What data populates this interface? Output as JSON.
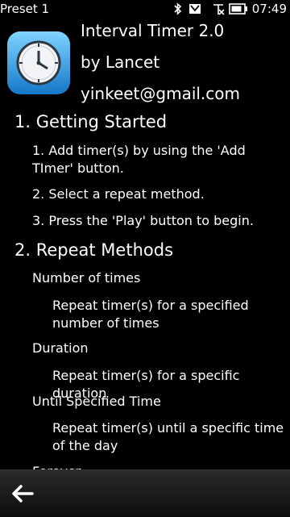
{
  "status": {
    "profile": "Preset 1",
    "time": "07:49",
    "icons": [
      "bluetooth-icon",
      "message-icon",
      "signal-icon",
      "battery-icon"
    ]
  },
  "app": {
    "title": "Interval Timer 2.0",
    "author": "by Lancet",
    "email": "yinkeet@gmail.com"
  },
  "getting_started": {
    "heading": "1. Getting Started",
    "steps": [
      "1. Add timer(s) by using the 'Add TImer' button.",
      "2. Select a repeat method.",
      "3. Press the 'Play' button to begin."
    ]
  },
  "repeat_methods": {
    "heading": "2. Repeat Methods",
    "items": [
      {
        "name": "Number of times",
        "desc": "Repeat timer(s) for a specified number of times"
      },
      {
        "name": "Duration",
        "desc": "Repeat timer(s) for a specific duration"
      },
      {
        "name": "Until Specified Time",
        "desc": "Repeat timer(s) until a specific time of the day"
      },
      {
        "name": "Forever",
        "desc": ""
      }
    ]
  },
  "toolbar": {
    "back_icon": "back-arrow-icon"
  }
}
